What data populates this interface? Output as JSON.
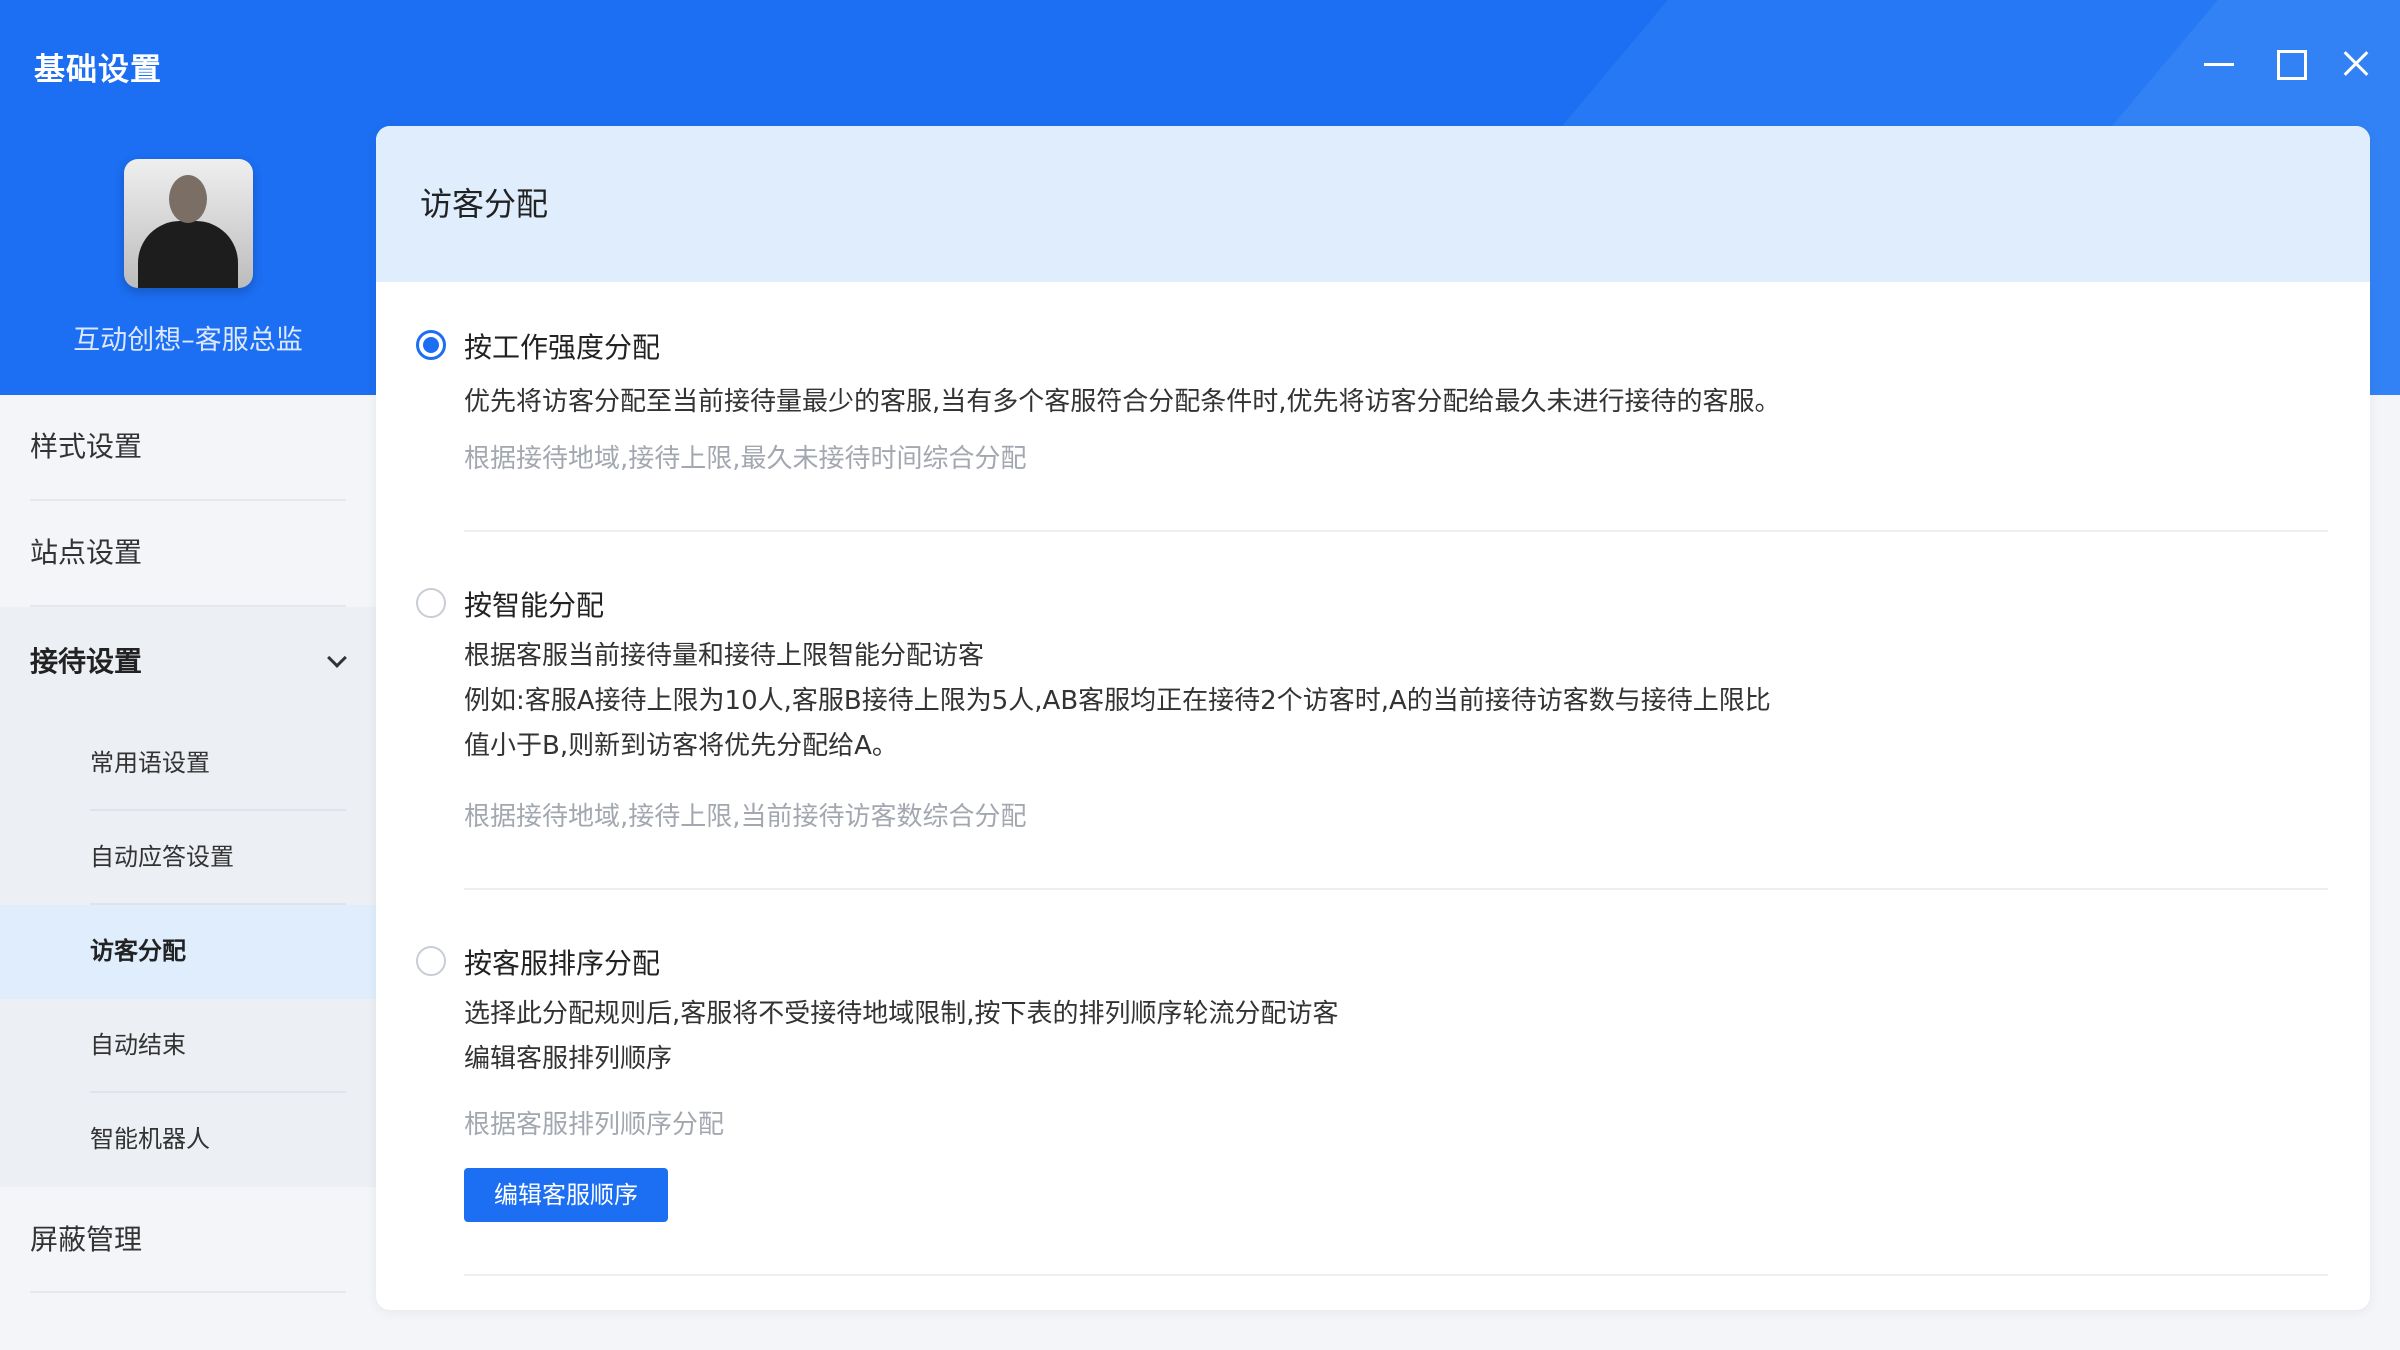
{
  "window": {
    "title": "基础设置",
    "controls": [
      "minimize-icon",
      "maximize-icon",
      "close-icon"
    ]
  },
  "profile": {
    "name": "互动创想–客服总监"
  },
  "sidebar": {
    "style_settings": "样式设置",
    "site_settings": "站点设置",
    "reception_group": {
      "label": "接待设置",
      "items": [
        {
          "label": "常用语设置"
        },
        {
          "label": "自动应答设置"
        },
        {
          "label": "访客分配",
          "active": true
        },
        {
          "label": "自动结束"
        },
        {
          "label": "智能机器人"
        }
      ]
    },
    "block_management": "屏蔽管理"
  },
  "panel": {
    "title": "访客分配",
    "options": [
      {
        "label": "按工作强度分配",
        "selected": true,
        "desc": [
          "优先将访客分配至当前接待量最少的客服,当有多个客服符合分配条件时,优先将访客分配给最久未进行接待的客服。"
        ],
        "hint": "根据接待地域,接待上限,最久未接待时间综合分配"
      },
      {
        "label": "按智能分配",
        "selected": false,
        "desc": [
          "根据客服当前接待量和接待上限智能分配访客",
          "例如:客服A接待上限为10人,客服B接待上限为5人,AB客服均正在接待2个访客时,A的当前接待访客数与接待上限比",
          "值小于B,则新到访客将优先分配给A。"
        ],
        "hint": "根据接待地域,接待上限,当前接待访客数综合分配"
      },
      {
        "label": "按客服排序分配",
        "selected": false,
        "desc": [
          "选择此分配规则后,客服将不受接待地域限制,按下表的排列顺序轮流分配访客",
          "编辑客服排列顺序"
        ],
        "hint": "根据客服排列顺序分配",
        "button": "编辑客服顺序"
      }
    ]
  },
  "colors": {
    "accent": "#1c6ef2",
    "panel_header_bg": "#dfedfd",
    "hint_text": "#a3a8b0"
  }
}
